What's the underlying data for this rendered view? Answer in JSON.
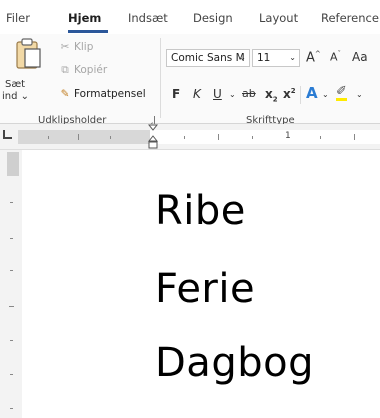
{
  "tabs": [
    "Filer",
    "Hjem",
    "Indsæt",
    "Design",
    "Layout",
    "Reference"
  ],
  "active_tab": "Hjem",
  "clipboard": {
    "paste_label": "Sæt",
    "paste_sub": "ind ⌄",
    "cut": "Klip",
    "copy": "Kopiér",
    "format_painter": "Formatpensel",
    "group_label": "Udklipsholder"
  },
  "font": {
    "name": "Comic Sans M",
    "size": "11",
    "grow_glyph": "A",
    "shrink_glyph": "A",
    "case_glyph": "Aa",
    "bold": "F",
    "italic": "K",
    "underline": "U",
    "strikethrough": "ab",
    "subscript": "x",
    "superscript": "x",
    "text_effects": "A",
    "group_label": "Skrifttype"
  },
  "ruler": {
    "number": "1"
  },
  "document": {
    "lines": [
      "Ribe",
      "Ferie",
      "Dagbog"
    ]
  },
  "colors": {
    "accent": "#2b579a",
    "highlight": "#ffeb00",
    "text_effect": "#2b7cd3"
  }
}
